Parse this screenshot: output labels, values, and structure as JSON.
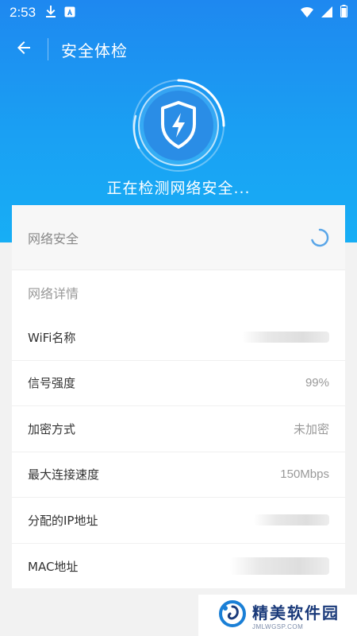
{
  "status_bar": {
    "time": "2:53"
  },
  "app_bar": {
    "title": "安全体检"
  },
  "scan": {
    "status_text": "正在检测网络安全..."
  },
  "card": {
    "network_security_label": "网络安全",
    "details_title": "网络详情",
    "rows": [
      {
        "label": "WiFi名称",
        "value": ""
      },
      {
        "label": "信号强度",
        "value": "99%"
      },
      {
        "label": "加密方式",
        "value": "未加密"
      },
      {
        "label": "最大连接速度",
        "value": "150Mbps"
      },
      {
        "label": "分配的IP地址",
        "value": ""
      },
      {
        "label": "MAC地址",
        "value": ""
      }
    ]
  },
  "watermark": {
    "name": "精美软件园",
    "url": "JMLWGSP.COM"
  },
  "colors": {
    "header_top": "#1e88f0",
    "header_bottom": "#17aef5",
    "accent": "#1aa0f3"
  }
}
